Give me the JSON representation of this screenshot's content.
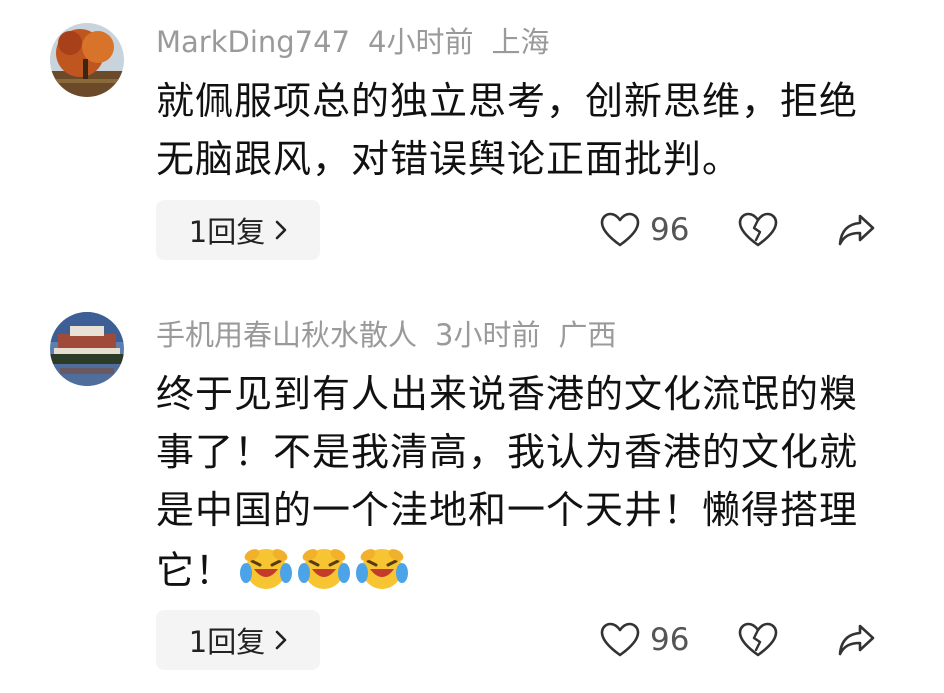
{
  "comments": [
    {
      "username": "MarkDing747",
      "time": "4小时前",
      "location": "上海",
      "text": "就佩服项总的独立思考，创新思维，拒绝无脑跟风，对错误舆论正面批判。",
      "reply_label": "1回复",
      "likes": "96",
      "avatar": "autumn-tree-avatar"
    },
    {
      "username": "手机用春山秋水散人",
      "time": "3小时前",
      "location": "广西",
      "text": "终于见到有人出来说香港的文化流氓的糗事了！不是我清高，我认为香港的文化就是中国的一个洼地和一个天井！懒得搭理它！",
      "reply_label": "1回复",
      "likes": "96",
      "avatar": "palace-lake-avatar",
      "emojis": [
        "laugh-cry-emoji",
        "laugh-cry-emoji",
        "laugh-cry-emoji"
      ]
    }
  ],
  "colors": {
    "meta": "#9a9a9a",
    "text": "#111111",
    "reply_bg": "#f4f4f4"
  }
}
